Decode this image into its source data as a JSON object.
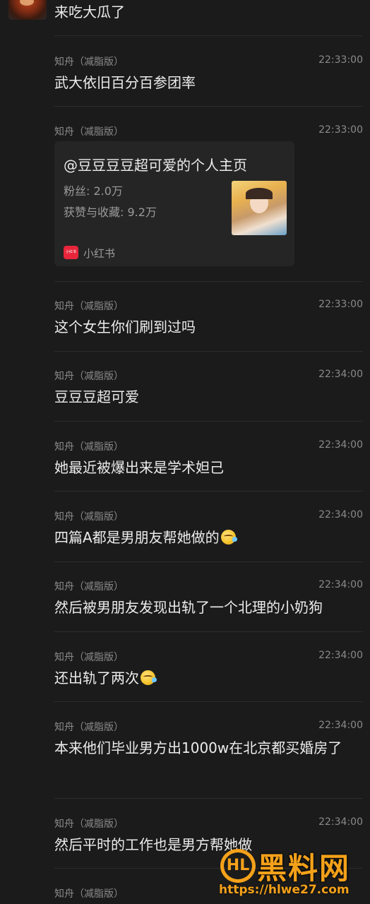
{
  "top_message": {
    "text": "来吃大瓜了"
  },
  "messages": [
    {
      "sender": "知舟（减脂版）",
      "time": "22:33:00",
      "text": "武大依旧百分百参团率"
    },
    {
      "sender": "知舟（减脂版）",
      "time": "22:33:00"
    },
    {
      "sender": "知舟（减脂版）",
      "time": "22:33:00",
      "text": "这个女生你们刷到过吗"
    },
    {
      "sender": "知舟（减脂版）",
      "time": "22:34:00",
      "text": "豆豆豆超可爱"
    },
    {
      "sender": "知舟（减脂版）",
      "time": "22:34:00",
      "text": "她最近被爆出来是学术妲己"
    },
    {
      "sender": "知舟（减脂版）",
      "time": "22:34:00",
      "text": "四篇A都是男朋友帮她做的",
      "emoji": "crying-laughing-emoji"
    },
    {
      "sender": "知舟（减脂版）",
      "time": "22:34:00",
      "text": "然后被男朋友发现出轨了一个北理的小奶狗"
    },
    {
      "sender": "知舟（减脂版）",
      "time": "22:34:00",
      "text": "还出轨了两次",
      "emoji": "crying-laughing-emoji"
    },
    {
      "sender": "知舟（减脂版）",
      "time": "22:34:00",
      "text": "本来他们毕业男方出1000w在北京都买婚房了"
    },
    {
      "sender": "知舟（减脂版）",
      "time": "22:34:00",
      "text": "然后平时的工作也是男方帮她做"
    },
    {
      "sender": "知舟（减脂版）",
      "time": ""
    }
  ],
  "card": {
    "title": "@豆豆豆豆超可爱的个人主页",
    "fans": "粉丝: 2.0万",
    "likes": "获赞与收藏: 9.2万",
    "app_logo_text": "小红书",
    "app_name": "小红书"
  },
  "watermark": {
    "icon_text": "HL",
    "name": "黑料网",
    "url": "https://hlwe27.com"
  },
  "colors": {
    "background": "#1b1b1b",
    "meta_text": "#8a8a8a",
    "body_text": "#ececec",
    "card_bg": "#252525",
    "xhs_red": "#e8253a",
    "watermark_orange": "#f4a11a"
  }
}
